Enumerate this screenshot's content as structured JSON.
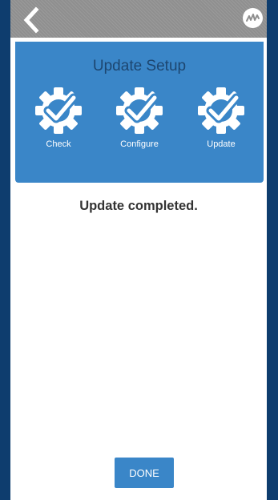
{
  "header": {
    "back_icon": "chevron-left-icon",
    "logo_icon": "brand-logo-icon"
  },
  "setup": {
    "title": "Update Setup",
    "steps": [
      {
        "label": "Check",
        "icon": "gear-check-icon",
        "status": "complete"
      },
      {
        "label": "Configure",
        "icon": "gear-check-icon",
        "status": "complete"
      },
      {
        "label": "Update",
        "icon": "gear-check-icon",
        "status": "complete"
      }
    ]
  },
  "status": {
    "message": "Update completed."
  },
  "actions": {
    "done_label": "DONE"
  },
  "colors": {
    "accent": "#3a86c8",
    "frame_border": "#0e3d6e",
    "topbar": "#8f8f8f",
    "title_text": "#1d4670"
  }
}
